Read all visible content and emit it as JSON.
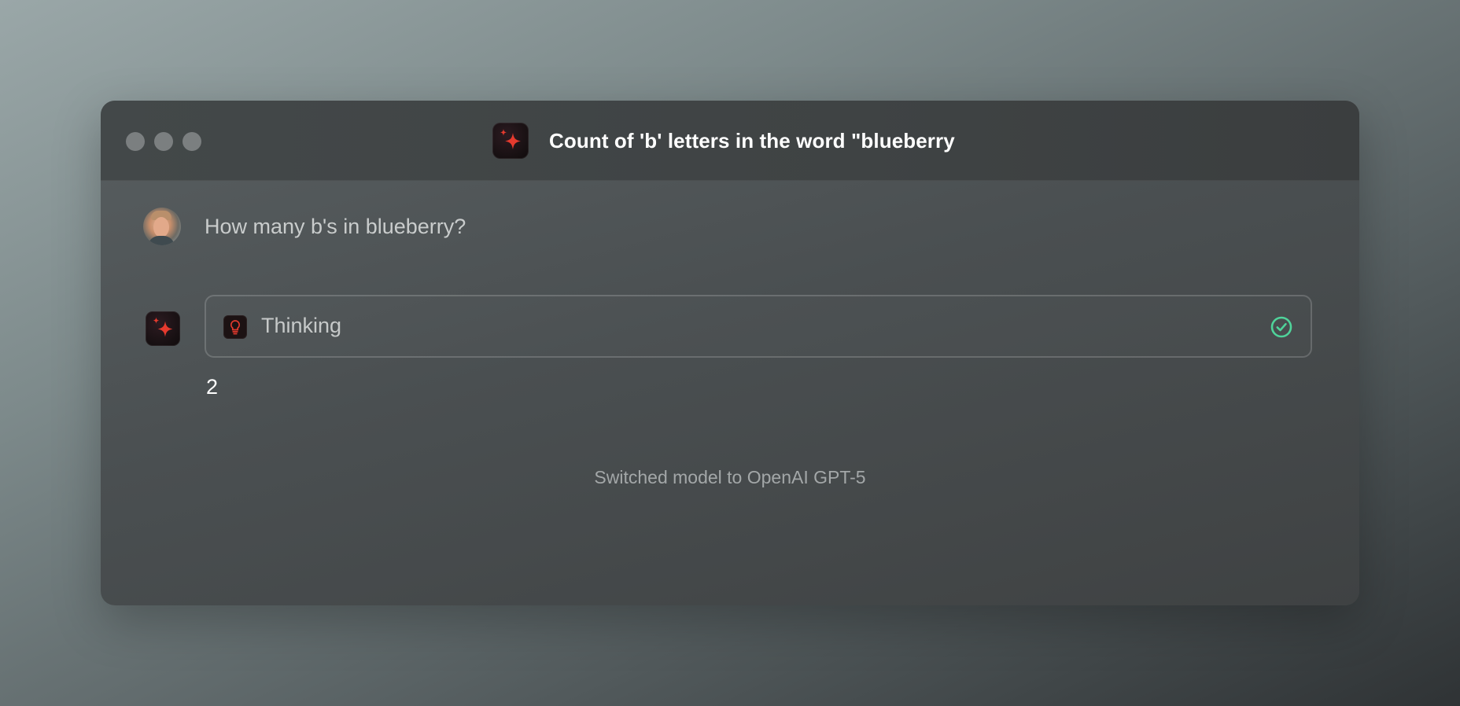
{
  "window": {
    "title": "Count of 'b' letters in the word \"blueberry",
    "app_icon": "sparkle-app-icon"
  },
  "conversation": {
    "user_message": "How many b's in blueberry?",
    "assistant": {
      "thinking_label": "Thinking",
      "thinking_status": "completed",
      "answer": "2"
    },
    "system_note": "Switched model to OpenAI GPT-5"
  },
  "colors": {
    "accent_red": "#e53a2e",
    "check_green": "#4fd39a"
  }
}
